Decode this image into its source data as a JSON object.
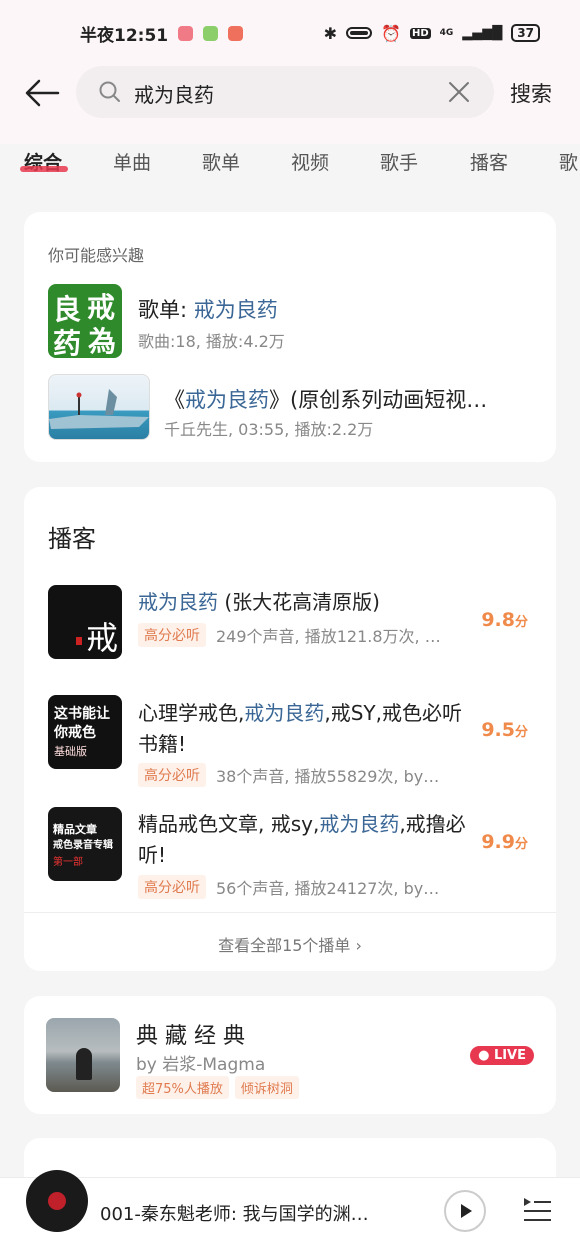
{
  "status": {
    "time": "半夜12:51",
    "network": "4G",
    "battery": "37"
  },
  "header": {
    "search_value": "戒为良药",
    "search_button": "搜索"
  },
  "tabs": [
    "综合",
    "单曲",
    "歌单",
    "视频",
    "歌手",
    "播客",
    "歌"
  ],
  "interest": {
    "hint": "你可能感兴趣",
    "playlist": {
      "prefix": "歌单: ",
      "name": "戒为良药",
      "meta": "歌曲:18, 播放:4.2万",
      "cover_text": [
        "良",
        "戒",
        "药",
        "為"
      ]
    },
    "video": {
      "prefix": "《",
      "name": "戒为良药",
      "suffix": "》(原创系列动画短视…",
      "meta": "千丘先生, 03:55, 播放:2.2万"
    }
  },
  "podcasts": {
    "title": "播客",
    "items": [
      {
        "title_hl": "戒为良药",
        "title_rest": " (张大花高清原版)",
        "tag": "高分必听",
        "meta": "249个声音, 播放121.8万次, …",
        "score": "9.8",
        "score_unit": "分",
        "cover_text": "戒"
      },
      {
        "title_pre": "心理学戒色,",
        "title_hl": "戒为良药",
        "title_rest": ",戒SY,戒色必听书籍!",
        "tag": "高分必听",
        "meta": "38个声音, 播放55829次, by…",
        "score": "9.5",
        "score_unit": "分",
        "cover_lines": [
          "这书能让",
          "你戒色"
        ],
        "cover_tag": "基础版"
      },
      {
        "title_pre": "精品戒色文章, 戒sy,",
        "title_hl": "戒为良药",
        "title_rest": ",戒撸必听!",
        "tag": "高分必听",
        "meta": "56个声音, 播放24127次, by…",
        "score": "9.9",
        "score_unit": "分",
        "cover_lines": [
          "精品文章",
          "戒色录音专辑"
        ],
        "cover_tag": "第一部"
      }
    ],
    "view_all": "查看全部15个播单 "
  },
  "live": {
    "title": "典 藏 经 典",
    "by": "by 岩浆-Magma",
    "tags": [
      "超75%人播放",
      "倾诉树洞"
    ],
    "badge": "LIVE"
  },
  "player": {
    "title": "001-秦东魁老师: 我与国学的渊…"
  },
  "colors": {
    "accent": "#e8384f",
    "highlight": "#3b6796",
    "score": "#f08a4b"
  }
}
